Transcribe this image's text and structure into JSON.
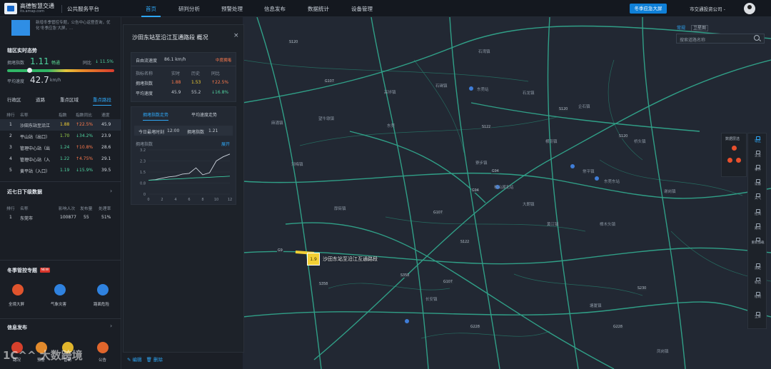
{
  "topbar": {
    "brand": "高德智慧交通",
    "brand_url": "its.amap.com",
    "platform": "公共服务平台",
    "nav": [
      "首页",
      "研判分析",
      "预警处理",
      "信息发布",
      "数据统计",
      "设备管理"
    ],
    "emergency_button": "冬季应急大屏",
    "company": "市交通投资公司 -"
  },
  "sidebar": {
    "notice": "新增冬季管控专题，公告中心返登查询，优化'冬季应急'大屏，...",
    "realtime": {
      "title": "辖区实时态势",
      "index_label": "拥堵指数",
      "index_value": "1.11",
      "index_status": "畅通",
      "compare_label": "同比",
      "compare_value": "↓ 11.5%",
      "speed_label": "平均速度",
      "speed_value": "42.7",
      "speed_unit": "km/h"
    },
    "tabs": [
      "行政区",
      "道路",
      "重点区域",
      "重点路",
      "重点路段"
    ],
    "table_headers": [
      "排行",
      "名称",
      "指数",
      "指数同比",
      "速度"
    ],
    "rows": [
      {
        "rank": "1",
        "name": "沙田东站至沿江",
        "index": "1.88",
        "yoy": "↑22.5%",
        "speed": "45.9"
      },
      {
        "rank": "2",
        "name": "平山站（出口）",
        "index": "1.70",
        "yoy": "↓34.2%",
        "speed": "23.9"
      },
      {
        "rank": "3",
        "name": "管理中心站（出",
        "index": "1.24",
        "yoy": "↑10.8%",
        "speed": "28.6"
      },
      {
        "rank": "4",
        "name": "管理中心站（入",
        "index": "1.22",
        "yoy": "↑4.75%",
        "speed": "29.1"
      },
      {
        "rank": "5",
        "name": "黄平站（入口）",
        "index": "1.19",
        "yoy": "↓15.9%",
        "speed": "39.5"
      }
    ],
    "seven_day": {
      "title": "近七日下级数据",
      "headers": [
        "排行",
        "名称",
        "影响人次",
        "发布量",
        "处理率"
      ],
      "row": {
        "rank": "1",
        "name": "东莞市",
        "people": "100877",
        "count": "55",
        "rate": "51%"
      }
    },
    "winter": {
      "title": "冬季管控专题",
      "new_badge": "NEW",
      "items": [
        "全境大屏",
        "气象灾害",
        "路面危险"
      ]
    },
    "info_release": {
      "title": "信息发布",
      "items": [
        "路况",
        "预警",
        "管制",
        "公告"
      ]
    },
    "watermark": "1C^^ 大数跨境"
  },
  "panel": {
    "title": "沙田东站至沿江互通路段 概况",
    "free_speed_label": "自由流速度",
    "free_speed_value": "86.1 km/h",
    "severity": "中度拥堵",
    "metric_headers": [
      "指标名称",
      "实时",
      "历史",
      "同比"
    ],
    "metrics": [
      {
        "name": "拥堵指数",
        "realtime": "1.88",
        "history": "1.53",
        "yoy": "↑22.5%"
      },
      {
        "name": "平均速度",
        "realtime": "45.9",
        "history": "55.2",
        "yoy": "↓16.8%"
      }
    ],
    "chart_tabs": [
      "拥堵指数走势",
      "平均速度走势"
    ],
    "peak_time_label": "今日最堵时刻",
    "peak_time_value": "12:00",
    "peak_index_label": "拥堵指数",
    "peak_index_value": "1.21",
    "chart_label": "拥堵指数",
    "expand": "展开",
    "edit": "编辑",
    "delete": "删除"
  },
  "chart_data": {
    "type": "line",
    "x": [
      0,
      2,
      4,
      6,
      8,
      10,
      12
    ],
    "ylim": [
      0,
      3.2
    ],
    "yticks": [
      "3.2",
      "2.3",
      "1.5",
      "0.8",
      "0"
    ],
    "xticks": [
      "0",
      "2",
      "4",
      "6",
      "8",
      "10",
      "12"
    ],
    "series": [
      {
        "values": [
          1.0,
          1.05,
          1.15,
          1.25,
          1.3,
          1.45,
          1.5,
          1.9,
          1.4,
          1.55,
          2.4,
          2.7,
          2.9
        ],
        "color": "#cfd6df"
      },
      {
        "values": [
          1.0,
          1.02,
          1.05,
          1.08,
          1.1,
          1.12,
          1.15,
          1.18,
          1.2,
          1.22,
          1.25,
          1.27,
          1.3
        ],
        "color": "#3bc9a0"
      }
    ]
  },
  "map": {
    "tabs": [
      "常规",
      "卫星图"
    ],
    "search_placeholder": "搜索道路名称",
    "callout_value": "1.9",
    "callout_name": "沙田东站至沿江互通路段",
    "layer_title": "数据层选",
    "labels": [
      {
        "t": "S120",
        "x": 64,
        "y": 33
      },
      {
        "t": "石湾镇",
        "x": 330,
        "y": 44
      },
      {
        "t": "石碣镇",
        "x": 270,
        "y": 92
      },
      {
        "t": "东莞站",
        "x": 328,
        "y": 97
      },
      {
        "t": "石龙镇",
        "x": 392,
        "y": 102
      },
      {
        "t": "高埗镇",
        "x": 198,
        "y": 101
      },
      {
        "t": "G107",
        "x": 114,
        "y": 88
      },
      {
        "t": "S120",
        "x": 442,
        "y": 127
      },
      {
        "t": "企石镇",
        "x": 470,
        "y": 121
      },
      {
        "t": "望牛墩镇",
        "x": 106,
        "y": 138
      },
      {
        "t": "麻涌镇",
        "x": 40,
        "y": 144
      },
      {
        "t": "东莞",
        "x": 202,
        "y": 148
      },
      {
        "t": "S122",
        "x": 334,
        "y": 152
      },
      {
        "t": "S120",
        "x": 526,
        "y": 165
      },
      {
        "t": "横沥镇",
        "x": 424,
        "y": 170
      },
      {
        "t": "桥头镇",
        "x": 548,
        "y": 170
      },
      {
        "t": "寮步镇",
        "x": 326,
        "y": 200
      },
      {
        "t": "洪梅镇",
        "x": 68,
        "y": 202
      },
      {
        "t": "G94",
        "x": 348,
        "y": 214
      },
      {
        "t": "松山湖北站",
        "x": 352,
        "y": 234
      },
      {
        "t": "东莞东站",
        "x": 506,
        "y": 226
      },
      {
        "t": "常平镇",
        "x": 476,
        "y": 212
      },
      {
        "t": "G94",
        "x": 320,
        "y": 241
      },
      {
        "t": "厚街镇",
        "x": 128,
        "y": 264
      },
      {
        "t": "大朗镇",
        "x": 392,
        "y": 258
      },
      {
        "t": "谢岗镇",
        "x": 590,
        "y": 240
      },
      {
        "t": "G107",
        "x": 266,
        "y": 272
      },
      {
        "t": "G9",
        "x": 48,
        "y": 325
      },
      {
        "t": "黄江镇",
        "x": 426,
        "y": 286
      },
      {
        "t": "樟木头镇",
        "x": 500,
        "y": 286
      },
      {
        "t": "S122",
        "x": 304,
        "y": 313
      },
      {
        "t": "S358",
        "x": 220,
        "y": 360
      },
      {
        "t": "G107",
        "x": 280,
        "y": 369
      },
      {
        "t": "长安镇",
        "x": 256,
        "y": 391
      },
      {
        "t": "塘厦镇",
        "x": 486,
        "y": 400
      },
      {
        "t": "凤岗镇",
        "x": 580,
        "y": 464
      },
      {
        "t": "S358",
        "x": 106,
        "y": 372
      },
      {
        "t": "G228",
        "x": 518,
        "y": 432
      },
      {
        "t": "G228",
        "x": 318,
        "y": 432
      },
      {
        "t": "S230",
        "x": 552,
        "y": 378
      }
    ]
  },
  "right_tools": [
    "辖区",
    "企业",
    "事件",
    "设备",
    "天气",
    "拉简",
    "路况",
    "重新加载",
    "测距",
    "标记",
    "绘制",
    "全屏"
  ],
  "colors": {
    "accent": "#2ea6f5",
    "good": "#4fd3a0",
    "warn": "#ff7a4d",
    "yellow": "#f2cf34"
  }
}
